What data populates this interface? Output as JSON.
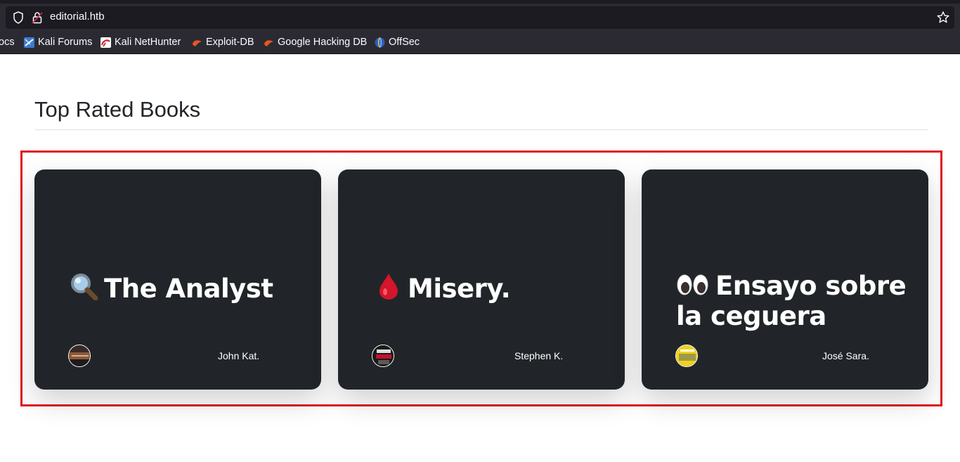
{
  "browser": {
    "url": "editorial.htb",
    "bookmarks": [
      {
        "label": "ocs",
        "icon": "docs-icon"
      },
      {
        "label": "Kali Forums",
        "icon": "kali-forums-icon"
      },
      {
        "label": "Kali NetHunter",
        "icon": "kali-nethunter-icon"
      },
      {
        "label": "Exploit-DB",
        "icon": "exploit-db-icon"
      },
      {
        "label": "Google Hacking DB",
        "icon": "google-hacking-db-icon"
      },
      {
        "label": "OffSec",
        "icon": "offsec-icon"
      }
    ]
  },
  "page": {
    "heading": "Top Rated Books",
    "highlight_color": "#e0141e",
    "books": [
      {
        "emoji": "🔍",
        "title": "The Analyst",
        "author": "John Kat."
      },
      {
        "emoji": "🩸",
        "title": "Misery.",
        "author": "Stephen K."
      },
      {
        "emoji": "👀",
        "title": "Ensayo sobre la ceguera",
        "author": "José Sara."
      }
    ]
  }
}
